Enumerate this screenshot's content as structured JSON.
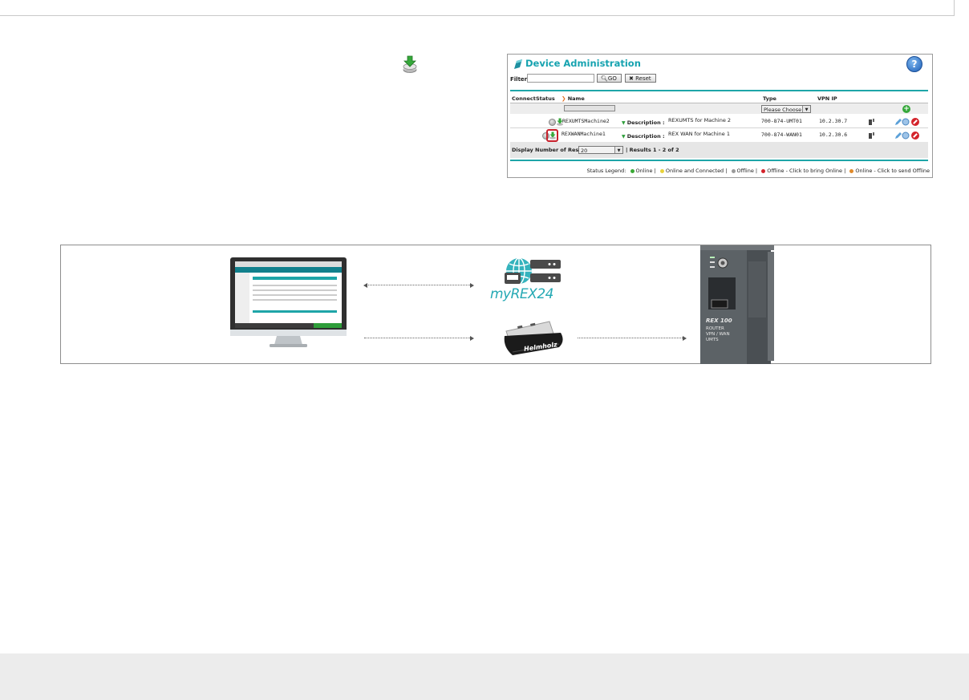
{
  "panel": {
    "title": "Device Administration",
    "help_glyph": "?",
    "filter_label": "Filter:",
    "filter_value": "",
    "go_label": "GO",
    "reset_label": "Reset",
    "columns": {
      "connect": "Connect",
      "status": "Status",
      "name": "Name",
      "type": "Type",
      "vpn_ip": "VPN IP"
    },
    "type_select": "Please Choose",
    "devices": [
      {
        "name": "REXUMTSMachine2",
        "description_label": "Description :",
        "description": "REXUMTS for Machine 2",
        "type": "700-874-UMT01",
        "vpn_ip": "10.2.30.7"
      },
      {
        "name": "REXWANMachine1",
        "description_label": "Description :",
        "description": "REX WAN for Machine 1",
        "type": "700-874-WAN01",
        "vpn_ip": "10.2.30.6"
      }
    ],
    "results_label": "Display Number of Results",
    "results_count": "20",
    "results_range": "|  Results 1 - 2 of 2",
    "legend": {
      "prefix": "Status Legend:",
      "online": "Online |",
      "online_connected": "Online and Connected |",
      "offline": "Offline |",
      "offline_bring": "Offline - Click to bring Online |",
      "online_send": "Online - Click to send Offline"
    },
    "colors": {
      "accent": "#16a3b0",
      "online": "#3aa935",
      "connected": "#e8d23a",
      "offline": "#9a9a9a",
      "offline_bring": "#d4232b",
      "online_send": "#e08a2a"
    }
  },
  "diagram": {
    "brand": "myREX",
    "brand_number": "24",
    "usb_label": "Helmholz",
    "router": {
      "model": "REX 100",
      "line1": "ROUTER",
      "line2": "VPN / WAN",
      "line3": "UMTS"
    }
  },
  "icons": {
    "inline_status": "green-upload-disk-icon",
    "title": "device-admin-icon",
    "help": "help-icon",
    "add": "add-icon",
    "globe_server": "cloud-server-icon",
    "usb_stick": "usb-stick-icon",
    "router": "router-device-icon",
    "monitor": "computer-monitor-icon"
  }
}
